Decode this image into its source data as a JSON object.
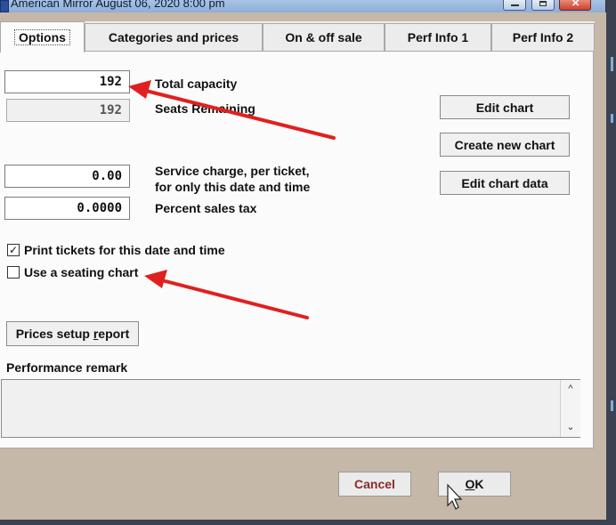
{
  "window": {
    "title": "American Mirror August 06, 2020 8:00 pm"
  },
  "tabs": [
    {
      "label": "Options"
    },
    {
      "label": "Categories and prices"
    },
    {
      "label": "On & off sale"
    },
    {
      "label": "Perf Info 1"
    },
    {
      "label": "Perf Info 2"
    }
  ],
  "fields": {
    "total_capacity": {
      "value": "192",
      "label": "Total capacity"
    },
    "seats_remaining": {
      "value": "192",
      "label": "Seats Remaining"
    },
    "service_charge": {
      "value": "0.00",
      "label_line1": "Service charge, per ticket,",
      "label_line2": "for only this date and time"
    },
    "sales_tax": {
      "value": "0.0000",
      "label": "Percent sales tax"
    }
  },
  "chart_buttons": {
    "edit_chart": "Edit chart",
    "create_new_chart": "Create new chart",
    "edit_chart_data": "Edit chart data"
  },
  "checkboxes": {
    "print_tickets": {
      "label": "Print tickets for this date and time",
      "checked": true
    },
    "seating_chart": {
      "label": "Use a seating chart",
      "checked": false
    }
  },
  "prices_report": {
    "label_pre": "Prices setup ",
    "label_u": "r",
    "label_post": "eport"
  },
  "remark": {
    "label": "Performance remark",
    "value": ""
  },
  "footer": {
    "cancel": "Cancel",
    "ok_u": "O",
    "ok_rest": "K"
  },
  "icons": {
    "scroll_up": "chevron-up-icon",
    "scroll_down": "chevron-down-icon",
    "check": "checkmark-icon"
  },
  "colors": {
    "annotation_arrow": "#e02020",
    "title_bar": "#9ab8de",
    "cancel_text": "#8a2a2a"
  }
}
